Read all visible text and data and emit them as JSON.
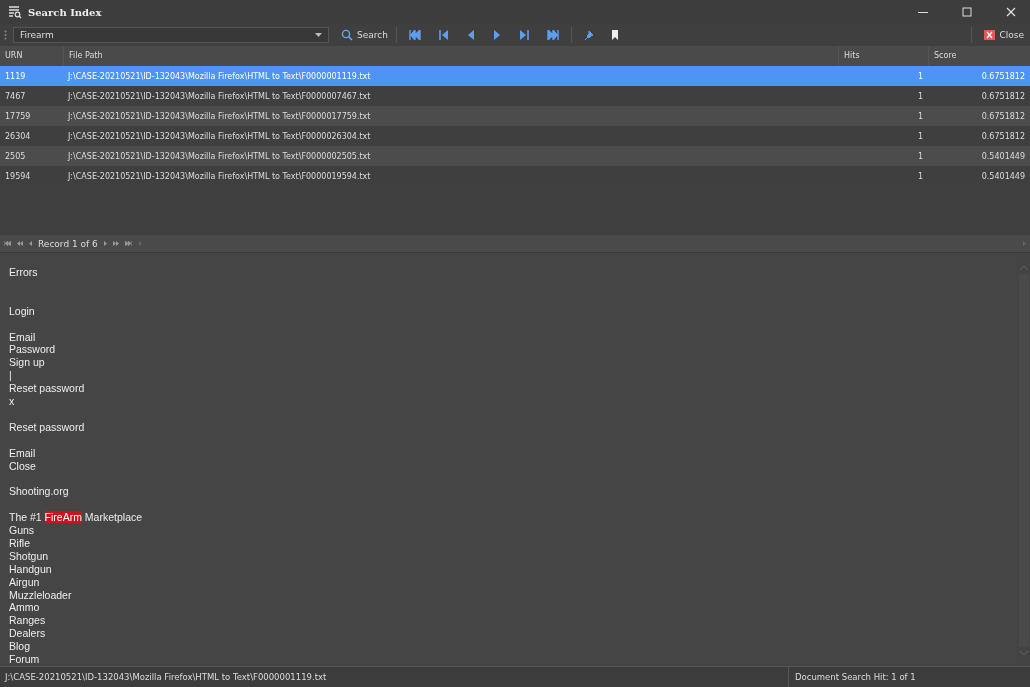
{
  "window": {
    "title": "Search Index"
  },
  "toolbar": {
    "query": "Firearm",
    "search_label": "Search",
    "close_label": "Close"
  },
  "table": {
    "columns": [
      "URN",
      "File Path",
      "Hits",
      "Score"
    ],
    "rows": [
      {
        "urn": "1119",
        "path": "J:\\CASE-20210521\\ID-132043\\Mozilla Firefox\\HTML to Text\\F0000001119.txt",
        "hits": "1",
        "score": "0.6751812",
        "selected": true
      },
      {
        "urn": "7467",
        "path": "J:\\CASE-20210521\\ID-132043\\Mozilla Firefox\\HTML to Text\\F0000007467.txt",
        "hits": "1",
        "score": "0.6751812",
        "selected": false
      },
      {
        "urn": "17759",
        "path": "J:\\CASE-20210521\\ID-132043\\Mozilla Firefox\\HTML to Text\\F0000017759.txt",
        "hits": "1",
        "score": "0.6751812",
        "selected": false
      },
      {
        "urn": "26304",
        "path": "J:\\CASE-20210521\\ID-132043\\Mozilla Firefox\\HTML to Text\\F0000026304.txt",
        "hits": "1",
        "score": "0.6751812",
        "selected": false
      },
      {
        "urn": "2505",
        "path": "J:\\CASE-20210521\\ID-132043\\Mozilla Firefox\\HTML to Text\\F0000002505.txt",
        "hits": "1",
        "score": "0.5401449",
        "selected": false
      },
      {
        "urn": "19594",
        "path": "J:\\CASE-20210521\\ID-132043\\Mozilla Firefox\\HTML to Text\\F0000019594.txt",
        "hits": "1",
        "score": "0.5401449",
        "selected": false
      }
    ]
  },
  "navigator": {
    "record": "Record 1 of 6"
  },
  "document": {
    "blocks": [
      {
        "lines": [
          [
            {
              "text": "Errors",
              "highlighted": false
            }
          ]
        ]
      },
      {
        "lines": [
          [
            {
              "text": "Login",
              "highlighted": false
            }
          ]
        ]
      },
      {
        "lines": [
          [
            {
              "text": "Email",
              "highlighted": false
            }
          ],
          [
            {
              "text": "Password",
              "highlighted": false
            }
          ],
          [
            {
              "text": "Sign up",
              "highlighted": false
            }
          ],
          [
            {
              "text": "|",
              "highlighted": false
            }
          ],
          [
            {
              "text": "Reset password",
              "highlighted": false
            }
          ],
          [
            {
              "text": "x",
              "highlighted": false
            }
          ]
        ]
      },
      {
        "lines": [
          [
            {
              "text": "Reset password",
              "highlighted": false
            }
          ]
        ]
      },
      {
        "lines": [
          [
            {
              "text": "Email",
              "highlighted": false
            }
          ],
          [
            {
              "text": "Close",
              "highlighted": false
            }
          ]
        ]
      },
      {
        "lines": [
          [
            {
              "text": "Shooting.org",
              "highlighted": false
            }
          ]
        ]
      },
      {
        "lines": [
          [
            {
              "text": "The #1 ",
              "highlighted": false
            },
            {
              "text": "FireArm",
              "highlighted": true
            },
            {
              "text": " Marketplace",
              "highlighted": false
            }
          ],
          [
            {
              "text": "Guns",
              "highlighted": false
            }
          ],
          [
            {
              "text": "Rifle",
              "highlighted": false
            }
          ],
          [
            {
              "text": "Shotgun",
              "highlighted": false
            }
          ],
          [
            {
              "text": "Handgun",
              "highlighted": false
            }
          ],
          [
            {
              "text": "Airgun",
              "highlighted": false
            }
          ],
          [
            {
              "text": "Muzzleloader",
              "highlighted": false
            }
          ],
          [
            {
              "text": "Ammo",
              "highlighted": false
            }
          ],
          [
            {
              "text": "Ranges",
              "highlighted": false
            }
          ],
          [
            {
              "text": "Dealers",
              "highlighted": false
            }
          ],
          [
            {
              "text": "Blog",
              "highlighted": false
            }
          ],
          [
            {
              "text": "Forum",
              "highlighted": false
            }
          ]
        ]
      }
    ]
  },
  "status_bar": {
    "path": "J:\\CASE-20210521\\ID-132043\\Mozilla Firefox\\HTML to Text\\F0000001119.txt",
    "hit": "Document Search Hit: 1 of 1"
  }
}
